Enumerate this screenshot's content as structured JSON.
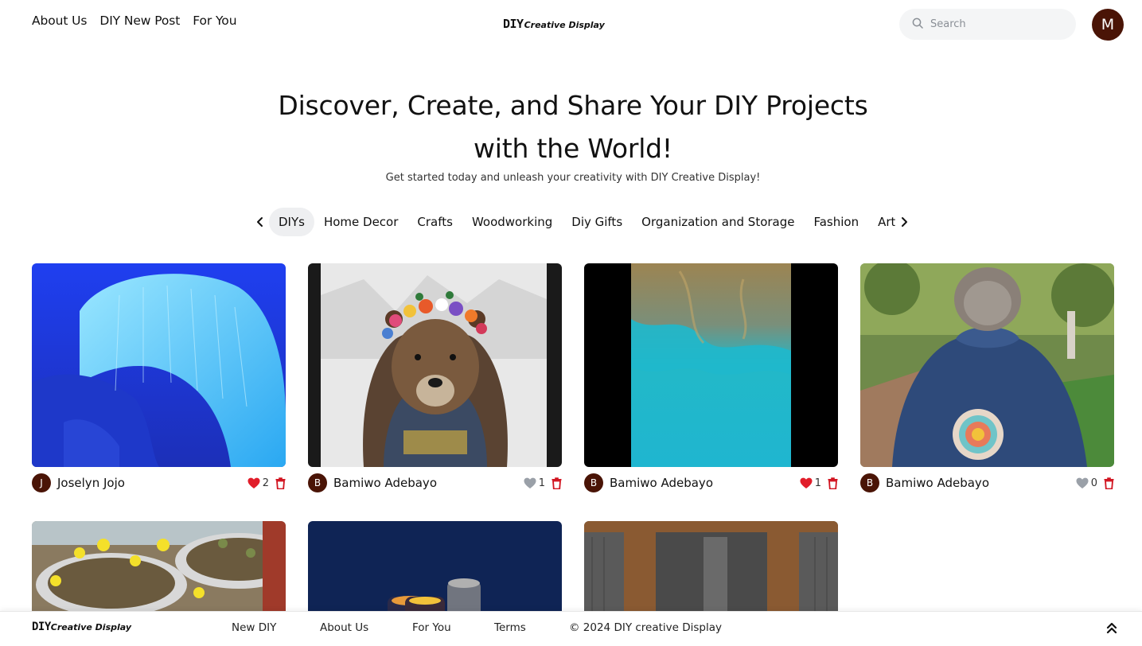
{
  "header": {
    "nav": [
      "About Us",
      "DIY New Post",
      "For You"
    ],
    "logo_main": "DIY",
    "logo_sub": "Creative Display",
    "search_placeholder": "Search",
    "user_initial": "M"
  },
  "hero": {
    "title_line1": "Discover, Create, and Share Your DIY Projects",
    "title_line2": "with the World!",
    "subtitle": "Get started today and unleash your creativity with DIY Creative Display!"
  },
  "categories": {
    "active": "DIYs",
    "items": [
      "DIYs",
      "Home Decor",
      "Crafts",
      "Woodworking",
      "Diy Gifts",
      "Organization and Storage",
      "Fashion",
      "Art"
    ]
  },
  "posts": [
    {
      "author": "Joselyn Jojo",
      "initial": "J",
      "likes": "2",
      "liked": true
    },
    {
      "author": "Bamiwo Adebayo",
      "initial": "B",
      "likes": "1",
      "liked": false
    },
    {
      "author": "Bamiwo Adebayo",
      "initial": "B",
      "likes": "1",
      "liked": true
    },
    {
      "author": "Bamiwo Adebayo",
      "initial": "B",
      "likes": "0",
      "liked": false
    }
  ],
  "footer": {
    "logo_main": "DIY",
    "logo_sub": "Creative Display",
    "links": [
      "New DIY",
      "About Us",
      "For You",
      "Terms"
    ],
    "copyright": "© 2024 DIY creative Display"
  },
  "colors": {
    "avatar": "#4a1406",
    "heart_liked": "#e11d2a",
    "heart_unliked": "#9aa0a8",
    "trash": "#d1131f",
    "pill_active": "#eeeff1"
  }
}
